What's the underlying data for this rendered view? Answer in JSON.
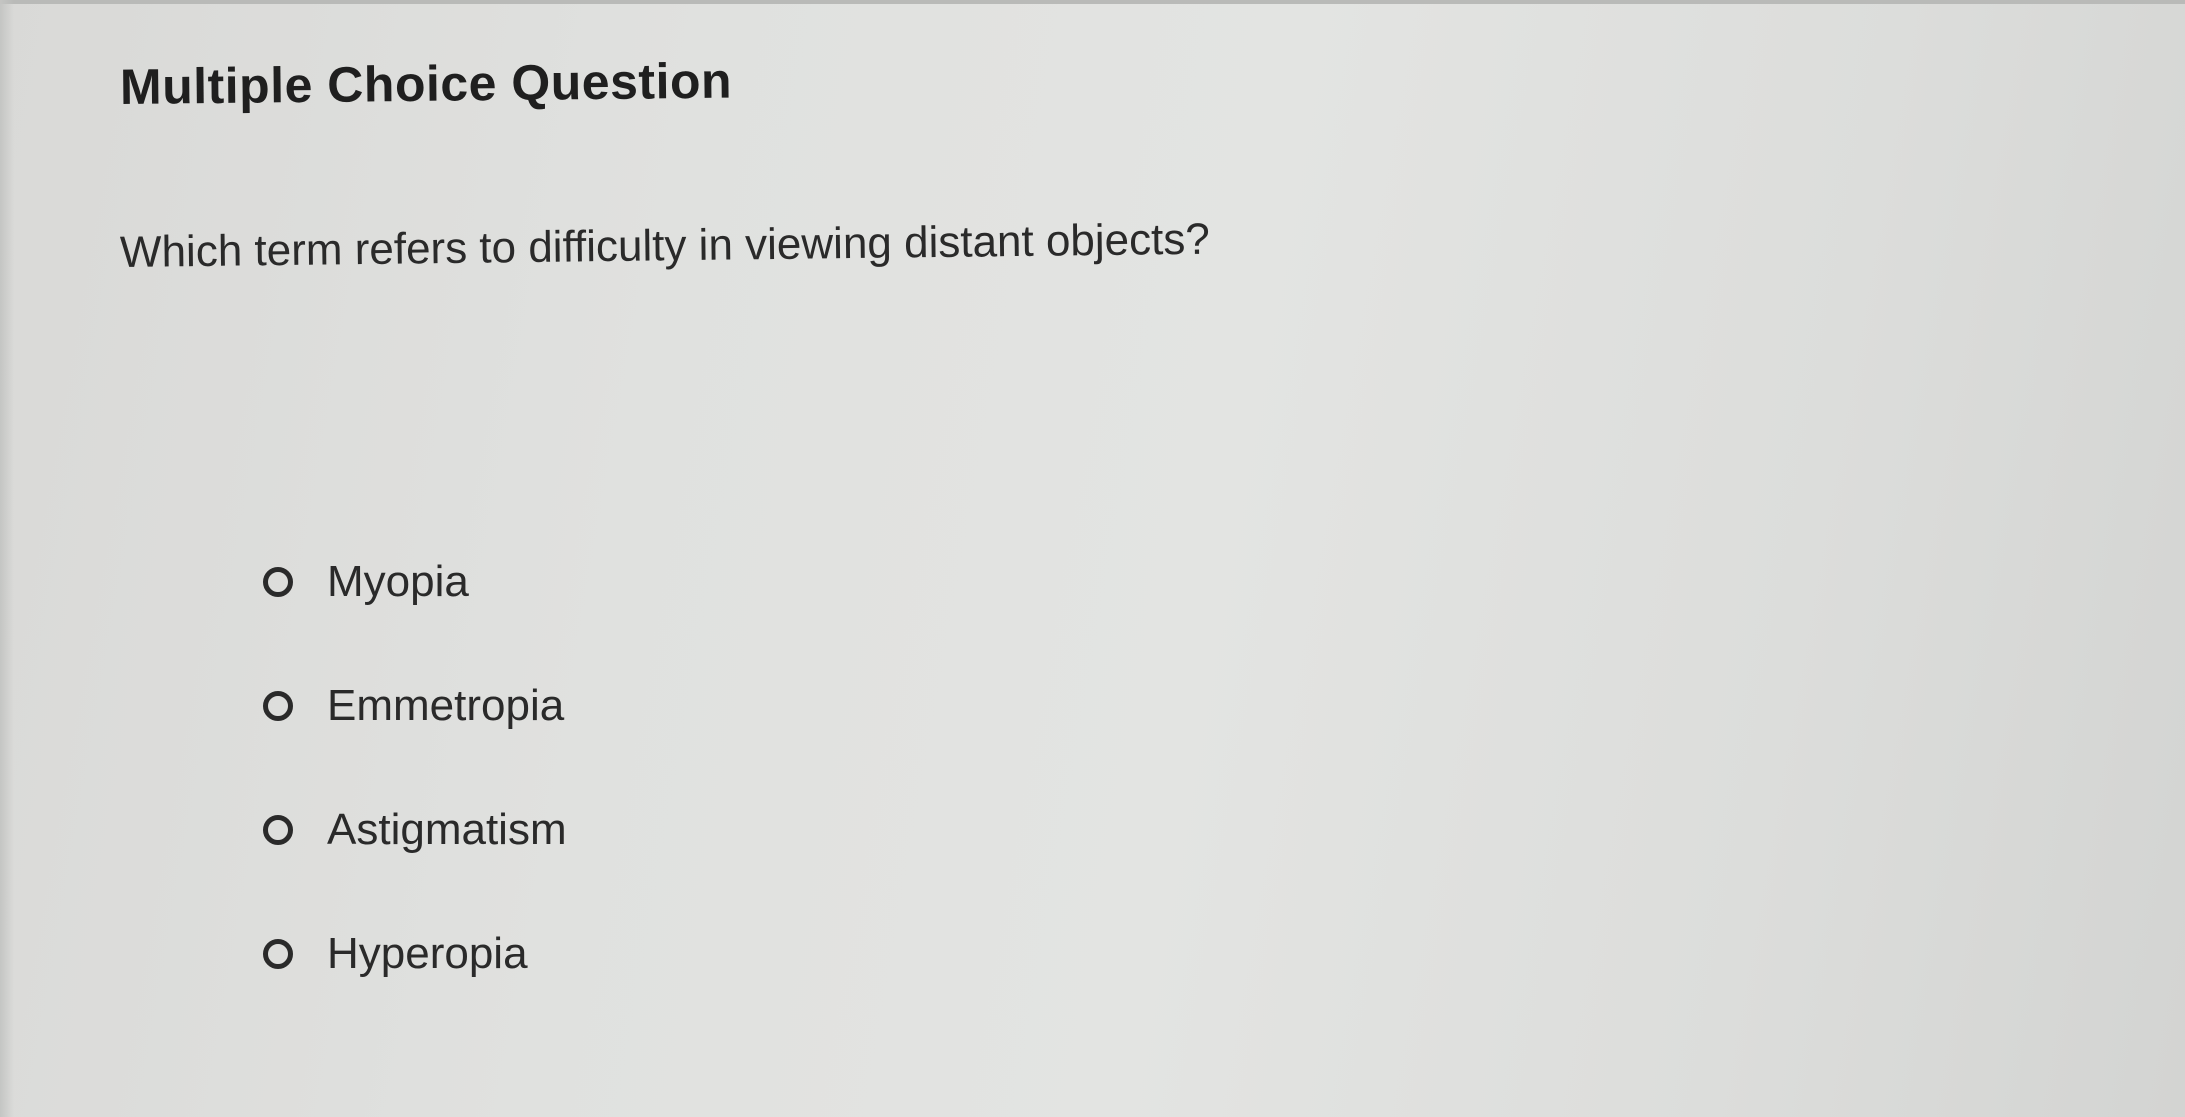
{
  "question": {
    "header": "Multiple Choice Question",
    "prompt": "Which term refers to difficulty in viewing distant objects?",
    "options": [
      {
        "label": "Myopia",
        "selected": false
      },
      {
        "label": "Emmetropia",
        "selected": false
      },
      {
        "label": "Astigmatism",
        "selected": false
      },
      {
        "label": "Hyperopia",
        "selected": false
      }
    ]
  }
}
